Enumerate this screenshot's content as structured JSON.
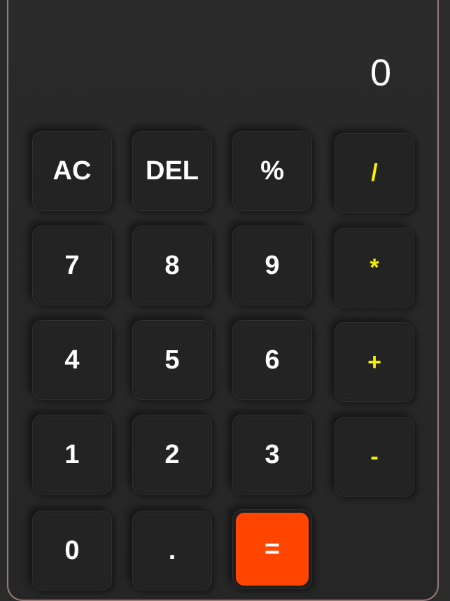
{
  "display": {
    "value": "0"
  },
  "buttons": {
    "ac": "AC",
    "del": "DEL",
    "percent": "%",
    "divide": "/",
    "seven": "7",
    "eight": "8",
    "nine": "9",
    "multiply": "*",
    "four": "4",
    "five": "5",
    "six": "6",
    "plus": "+",
    "one": "1",
    "two": "2",
    "three": "3",
    "minus": "-",
    "zero": "0",
    "dot": ".",
    "equals": "="
  },
  "colors": {
    "background": "#2b2b2b",
    "button": "#222222",
    "text": "#ffffff",
    "operator": "#f5f200",
    "equals": "#ff4500",
    "border": "#9a7b78"
  }
}
